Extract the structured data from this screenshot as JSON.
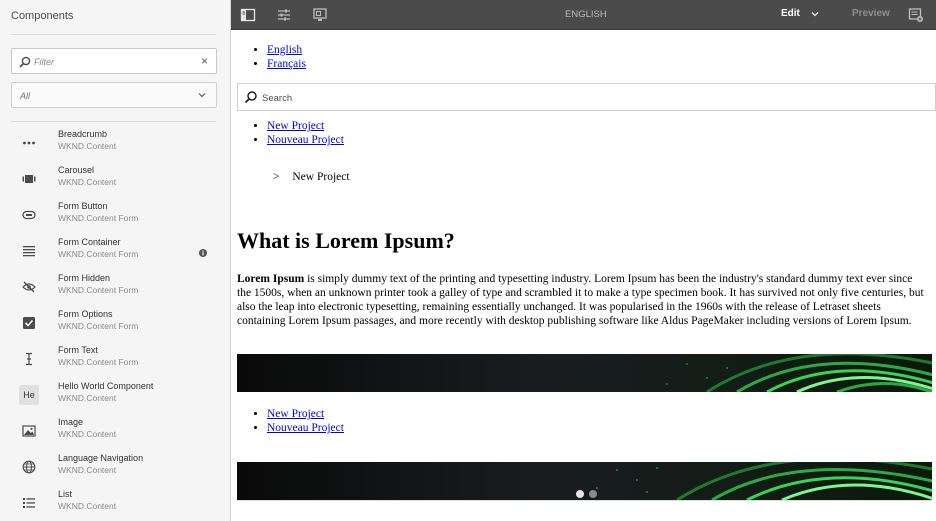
{
  "panel": {
    "title": "Components",
    "filter": {
      "placeholder": "Filter",
      "value": ""
    },
    "group_select": {
      "value": "All"
    },
    "items": [
      {
        "name": "Breadcrumb",
        "group": "WKND.Content",
        "icon": "more-horizontal-icon"
      },
      {
        "name": "Carousel",
        "group": "WKND.Content",
        "icon": "carousel-icon"
      },
      {
        "name": "Form Button",
        "group": "WKND.Content Form",
        "icon": "button-icon"
      },
      {
        "name": "Form Container",
        "group": "WKND.Content Form",
        "icon": "form-container-icon",
        "info": true
      },
      {
        "name": "Form Hidden",
        "group": "WKND.Content Form",
        "icon": "eye-off-icon"
      },
      {
        "name": "Form Options",
        "group": "WKND.Content Form",
        "icon": "checkbox-icon"
      },
      {
        "name": "Form Text",
        "group": "WKND.Content Form",
        "icon": "text-cursor-icon"
      },
      {
        "name": "Hello World Component",
        "group": "WKND.Content",
        "icon": "he-abbrev-icon",
        "abbrev": "He"
      },
      {
        "name": "Image",
        "group": "WKND.Content",
        "icon": "image-icon"
      },
      {
        "name": "Language Navigation",
        "group": "WKND.Content",
        "icon": "globe-icon"
      },
      {
        "name": "List",
        "group": "WKND.Content",
        "icon": "list-icon"
      }
    ]
  },
  "toolbar": {
    "language": "ENGLISH",
    "mode": "Edit",
    "preview": "Preview"
  },
  "page": {
    "language_nav": [
      "English",
      "Français"
    ],
    "search_placeholder": "Search",
    "navigation": [
      "New Project",
      "Nouveau Project"
    ],
    "breadcrumb": {
      "separator": ">",
      "current": "New Project"
    },
    "heading": "What is Lorem Ipsum?",
    "body_strong": "Lorem Ipsum",
    "body_text": " is simply dummy text of the printing and typesetting industry. Lorem Ipsum has been the industry's standard dummy text ever since the 1500s, when an unknown printer took a galley of type and scrambled it to make a type specimen book. It has survived not only five centuries, but also the leap into electronic typesetting, remaining essentially unchanged. It was popularised in the 1960s with the release of Letraset sheets containing Lorem Ipsum passages, and more recently with desktop publishing software like Aldus PageMaker including versions of Lorem Ipsum.",
    "navigation_2": [
      "New Project",
      "Nouveau Project"
    ],
    "carousel": {
      "slides": 2,
      "active": 1
    }
  },
  "colors": {
    "toolbar_bg": "#4b4b4b",
    "panel_bg": "#f5f5f5",
    "link": "#0000ee",
    "banner_green": "#39d353"
  }
}
